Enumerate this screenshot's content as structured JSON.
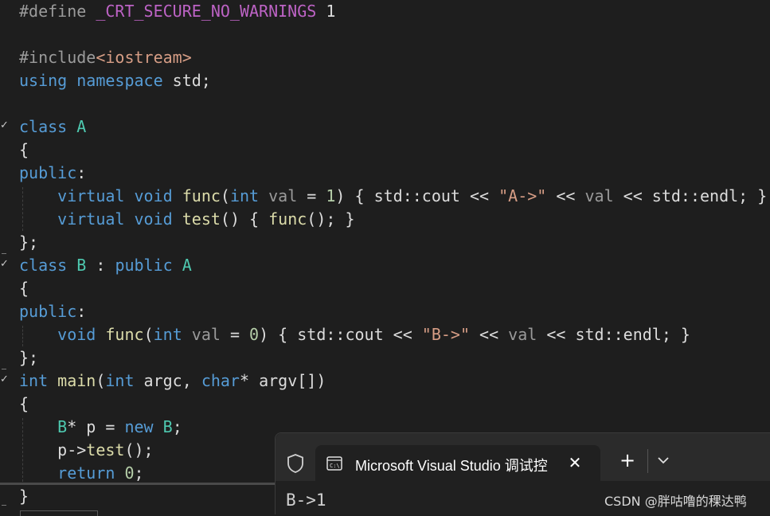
{
  "editor": {
    "lines": [
      [
        {
          "t": "#define ",
          "c": "directive"
        },
        {
          "t": "_CRT_SECURE_NO_WARNINGS",
          "c": "macro"
        },
        {
          "t": " 1",
          "c": "text"
        }
      ],
      [],
      [
        {
          "t": "#include",
          "c": "directive"
        },
        {
          "t": "<iostream>",
          "c": "string"
        }
      ],
      [
        {
          "t": "using",
          "c": "keyword"
        },
        {
          "t": " ",
          "c": "text"
        },
        {
          "t": "namespace",
          "c": "keyword"
        },
        {
          "t": " std;",
          "c": "text"
        }
      ],
      [],
      [
        {
          "t": "class",
          "c": "keyword"
        },
        {
          "t": " ",
          "c": "text"
        },
        {
          "t": "A",
          "c": "type"
        }
      ],
      [
        {
          "t": "{",
          "c": "text"
        }
      ],
      [
        {
          "t": "public",
          "c": "keyword"
        },
        {
          "t": ":",
          "c": "text"
        }
      ],
      [
        {
          "t": "    ",
          "c": "text"
        },
        {
          "t": "virtual",
          "c": "keyword"
        },
        {
          "t": " ",
          "c": "text"
        },
        {
          "t": "void",
          "c": "keyword"
        },
        {
          "t": " ",
          "c": "text"
        },
        {
          "t": "func",
          "c": "func"
        },
        {
          "t": "(",
          "c": "text"
        },
        {
          "t": "int",
          "c": "keyword"
        },
        {
          "t": " ",
          "c": "text"
        },
        {
          "t": "val",
          "c": "param"
        },
        {
          "t": " = ",
          "c": "text"
        },
        {
          "t": "1",
          "c": "number"
        },
        {
          "t": ") { std::cout << ",
          "c": "text"
        },
        {
          "t": "\"A->\"",
          "c": "string"
        },
        {
          "t": " << ",
          "c": "text"
        },
        {
          "t": "val",
          "c": "param"
        },
        {
          "t": " << std::endl; }",
          "c": "text"
        }
      ],
      [
        {
          "t": "    ",
          "c": "text"
        },
        {
          "t": "virtual",
          "c": "keyword"
        },
        {
          "t": " ",
          "c": "text"
        },
        {
          "t": "void",
          "c": "keyword"
        },
        {
          "t": " ",
          "c": "text"
        },
        {
          "t": "test",
          "c": "func"
        },
        {
          "t": "() { ",
          "c": "text"
        },
        {
          "t": "func",
          "c": "func"
        },
        {
          "t": "(); }",
          "c": "text"
        }
      ],
      [
        {
          "t": "};",
          "c": "text"
        }
      ],
      [
        {
          "t": "class",
          "c": "keyword"
        },
        {
          "t": " ",
          "c": "text"
        },
        {
          "t": "B",
          "c": "type"
        },
        {
          "t": " : ",
          "c": "text"
        },
        {
          "t": "public",
          "c": "keyword"
        },
        {
          "t": " ",
          "c": "text"
        },
        {
          "t": "A",
          "c": "type"
        }
      ],
      [
        {
          "t": "{",
          "c": "text"
        }
      ],
      [
        {
          "t": "public",
          "c": "keyword"
        },
        {
          "t": ":",
          "c": "text"
        }
      ],
      [
        {
          "t": "    ",
          "c": "text"
        },
        {
          "t": "void",
          "c": "keyword"
        },
        {
          "t": " ",
          "c": "text"
        },
        {
          "t": "func",
          "c": "func"
        },
        {
          "t": "(",
          "c": "text"
        },
        {
          "t": "int",
          "c": "keyword"
        },
        {
          "t": " ",
          "c": "text"
        },
        {
          "t": "val",
          "c": "param"
        },
        {
          "t": " = ",
          "c": "text"
        },
        {
          "t": "0",
          "c": "number"
        },
        {
          "t": ") { std::cout << ",
          "c": "text"
        },
        {
          "t": "\"B->\"",
          "c": "string"
        },
        {
          "t": " << ",
          "c": "text"
        },
        {
          "t": "val",
          "c": "param"
        },
        {
          "t": " << std::endl; }",
          "c": "text"
        }
      ],
      [
        {
          "t": "};",
          "c": "text"
        }
      ],
      [
        {
          "t": "int",
          "c": "keyword"
        },
        {
          "t": " ",
          "c": "text"
        },
        {
          "t": "main",
          "c": "func"
        },
        {
          "t": "(",
          "c": "text"
        },
        {
          "t": "int",
          "c": "keyword"
        },
        {
          "t": " argc, ",
          "c": "text"
        },
        {
          "t": "char",
          "c": "keyword"
        },
        {
          "t": "* argv[])",
          "c": "text"
        }
      ],
      [
        {
          "t": "{",
          "c": "text"
        }
      ],
      [
        {
          "t": "    ",
          "c": "text"
        },
        {
          "t": "B",
          "c": "type"
        },
        {
          "t": "* p = ",
          "c": "text"
        },
        {
          "t": "new",
          "c": "keyword"
        },
        {
          "t": " ",
          "c": "text"
        },
        {
          "t": "B",
          "c": "type"
        },
        {
          "t": ";",
          "c": "text"
        }
      ],
      [
        {
          "t": "    p->",
          "c": "text"
        },
        {
          "t": "test",
          "c": "func"
        },
        {
          "t": "();",
          "c": "text"
        }
      ],
      [
        {
          "t": "    ",
          "c": "text"
        },
        {
          "t": "return",
          "c": "keyword"
        },
        {
          "t": " ",
          "c": "text"
        },
        {
          "t": "0",
          "c": "number"
        },
        {
          "t": ";",
          "c": "text"
        }
      ],
      [
        {
          "t": "}",
          "c": "text"
        }
      ]
    ]
  },
  "terminal": {
    "tab_title": "Microsoft Visual Studio 调试控",
    "close_glyph": "✕",
    "new_tab_glyph": "+",
    "output": "B->1"
  },
  "watermark": "CSDN @胖咕噜的稞达鸭",
  "icons": {
    "shield": "shield-icon",
    "console": "console-icon",
    "dropdown": "chevron-down-icon"
  },
  "colors": {
    "editor_bg": "#1e1e1e",
    "keyword": "#569cd6",
    "type": "#4ec9b0",
    "function": "#dcdcaa",
    "string": "#d69d85",
    "macro": "#bd63c5",
    "number": "#b5cea8",
    "terminal_bg": "#202020",
    "tabbar_bg": "#2b2b2b"
  }
}
